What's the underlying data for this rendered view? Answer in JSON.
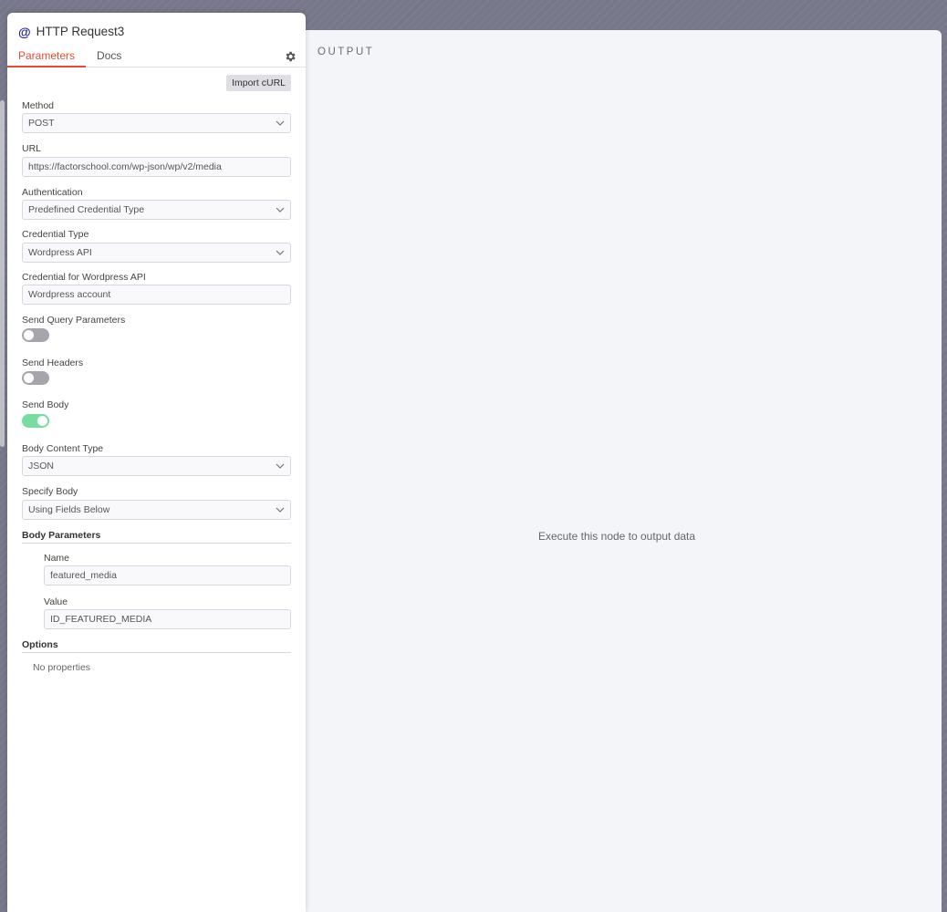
{
  "node": {
    "title": "HTTP Request3",
    "icon": "at-icon",
    "tabs": [
      {
        "label": "Parameters",
        "active": true
      },
      {
        "label": "Docs",
        "active": false
      }
    ]
  },
  "import_button": "Import cURL",
  "fields": {
    "method": {
      "label": "Method",
      "value": "POST"
    },
    "url": {
      "label": "URL",
      "value": "https://factorschool.com/wp-json/wp/v2/media"
    },
    "authentication": {
      "label": "Authentication",
      "value": "Predefined Credential Type"
    },
    "credential_type": {
      "label": "Credential Type",
      "value": "Wordpress API"
    },
    "credential": {
      "label": "Credential for Wordpress API",
      "value": "Wordpress account"
    },
    "send_query": {
      "label": "Send Query Parameters",
      "enabled": false
    },
    "send_headers": {
      "label": "Send Headers",
      "enabled": false
    },
    "send_body": {
      "label": "Send Body",
      "enabled": true
    },
    "body_content_type": {
      "label": "Body Content Type",
      "value": "JSON"
    },
    "specify_body": {
      "label": "Specify Body",
      "value": "Using Fields Below"
    }
  },
  "body_parameters": {
    "title": "Body Parameters",
    "name_label": "Name",
    "name_value": "featured_media",
    "value_label": "Value",
    "value_value": "ID_FEATURED_MEDIA"
  },
  "options": {
    "title": "Options",
    "empty": "No properties"
  },
  "output": {
    "title": "OUTPUT",
    "empty_message": "Execute this node to output data"
  },
  "colors": {
    "accent": "#ea4b30",
    "toggle_on": "#77dca0",
    "toggle_off": "#a5a5ad",
    "canvas": "#77778a"
  }
}
